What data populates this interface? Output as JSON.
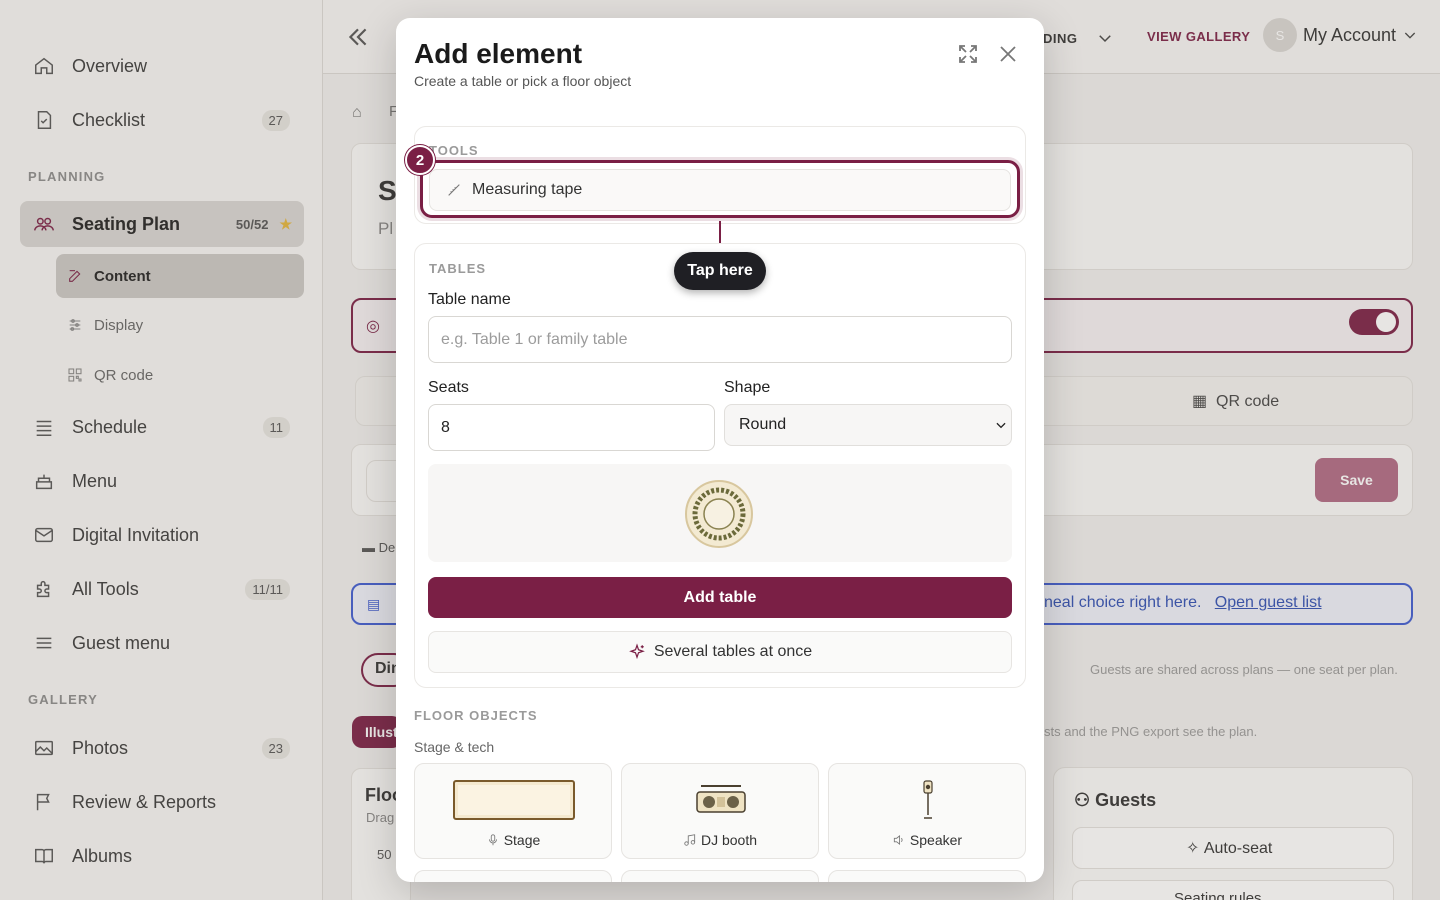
{
  "sidebar": {
    "items_top": [
      {
        "label": "Overview",
        "icon": "home-icon",
        "count": ""
      },
      {
        "label": "Checklist",
        "icon": "checklist-icon",
        "count": "27"
      }
    ],
    "planning_label": "PLANNING",
    "seating": {
      "label": "Seating Plan",
      "count": "50/52",
      "star": "★",
      "icon": "people-icon"
    },
    "sub_items": [
      {
        "label": "Content",
        "icon": "edit-icon"
      },
      {
        "label": "Display",
        "icon": "sliders-icon"
      },
      {
        "label": "QR code",
        "icon": "qr-icon"
      }
    ],
    "items_mid": [
      {
        "label": "Schedule",
        "icon": "list-icon",
        "count": "11"
      },
      {
        "label": "Menu",
        "icon": "cake-icon",
        "count": ""
      },
      {
        "label": "Digital Invitation",
        "icon": "mail-icon",
        "count": ""
      },
      {
        "label": "All Tools",
        "icon": "puzzle-icon",
        "count": "11/11"
      },
      {
        "label": "Guest menu",
        "icon": "menu-icon",
        "count": ""
      }
    ],
    "gallery_label": "GALLERY",
    "items_gallery": [
      {
        "label": "Photos",
        "icon": "image-icon",
        "count": "23"
      },
      {
        "label": "Review & Reports",
        "icon": "flag-icon",
        "count": ""
      },
      {
        "label": "Albums",
        "icon": "book-icon",
        "count": ""
      }
    ]
  },
  "topbar": {
    "wedding_label": "DING",
    "gallery_label": "VIEW GALLERY",
    "account_label": "My Account",
    "avatar_letter": "S"
  },
  "background": {
    "breadcrumb_partial": "F",
    "title_partial": "S",
    "subtitle_partial": "Pl",
    "qr_label": "QR code",
    "save_label": "Save",
    "lang_partial": "De",
    "info_text": "neal choice right here.",
    "info_link": "Open guest list",
    "din_partial": "Din",
    "guests_shared": "Guests are shared across plans — one seat per plan.",
    "illust_partial": "Illust",
    "png_note": "sts and the PNG export see the plan.",
    "floor_partial": "Floo",
    "drag_partial": "Drag",
    "zoom_partial": "50",
    "guests_title": "Guests",
    "auto_seat": "Auto-seat",
    "seating_rules": "Seating rules"
  },
  "modal": {
    "title": "Add element",
    "subtitle": "Create a table or pick a floor object",
    "tools_label": "TOOLS",
    "measuring_tape": "Measuring tape",
    "step_number": "2",
    "tip_text": "Tap here",
    "tables_label": "TABLES",
    "table_name_label": "Table name",
    "table_name_placeholder": "e.g. Table 1 or family table",
    "seats_label": "Seats",
    "seats_value": "8",
    "shape_label": "Shape",
    "shape_value": "Round",
    "add_table_label": "Add table",
    "several_label": "Several tables at once",
    "floor_objects_label": "FLOOR OBJECTS",
    "stage_tech_label": "Stage & tech",
    "objects": [
      {
        "label": "Stage",
        "icon": "mic-icon"
      },
      {
        "label": "DJ booth",
        "icon": "music-icon"
      },
      {
        "label": "Speaker",
        "icon": "speaker-icon"
      }
    ]
  },
  "colors": {
    "accent": "#7a1f45",
    "tooltip": "#1f1f24",
    "star": "#e3b53a",
    "link": "#2f4fb4"
  }
}
